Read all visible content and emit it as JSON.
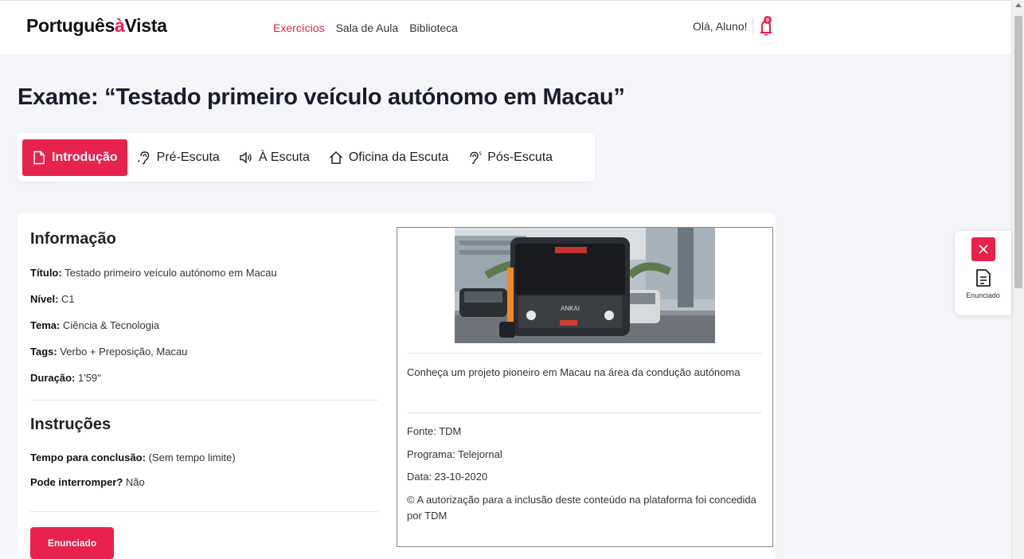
{
  "brand": {
    "part1": "Português",
    "accent": "à",
    "part2": "Vista",
    "accent_color": "#e8224e"
  },
  "nav": [
    {
      "label": "Exercícios",
      "active": true
    },
    {
      "label": "Sala de Aula",
      "active": false
    },
    {
      "label": "Biblioteca",
      "active": false
    }
  ],
  "user": {
    "greeting": "Olá, Aluno!",
    "notifications": "0"
  },
  "page_title": "Exame: “Testado primeiro veículo autónomo em Macau”",
  "tabs": [
    {
      "label": "Introdução",
      "icon": "file-icon",
      "active": true
    },
    {
      "label": "Pré-Escuta",
      "icon": "ear-icon",
      "active": false
    },
    {
      "label": "À Escuta",
      "icon": "speaker-icon",
      "active": false
    },
    {
      "label": "Oficina da Escuta",
      "icon": "home-icon",
      "active": false
    },
    {
      "label": "Pós-Escuta",
      "icon": "hearing-icon",
      "active": false
    }
  ],
  "info": {
    "heading": "Informação",
    "title_label": "Título:",
    "title_value": "Testado primeiro veículo autónomo em Macau",
    "level_label": "Nível:",
    "level_value": "C1",
    "theme_label": "Tema:",
    "theme_value": "Ciência & Tecnologia",
    "tags_label": "Tags:",
    "tags_value": "Verbo + Preposição, Macau",
    "duration_label": "Duração:",
    "duration_value": "1'59''"
  },
  "instructions": {
    "heading": "Instruções",
    "time_label": "Tempo para conclusão:",
    "time_value": "(Sem tempo limite)",
    "interrupt_label": "Pode interromper?",
    "interrupt_value": "Não"
  },
  "enunciado_button": "Enunciado",
  "media": {
    "description": "Conheça um projeto pioneiro em Macau na área da condução autónoma",
    "source": "Fonte: TDM",
    "program": "Programa: Telejornal",
    "date": "Data: 23-10-2020",
    "copyright": "© A autorização para a inclusão deste conteúdo na plataforma foi concedida por TDM",
    "bus_sign_text": "ANKAI"
  },
  "floating_panel": {
    "label": "Enunciado"
  }
}
